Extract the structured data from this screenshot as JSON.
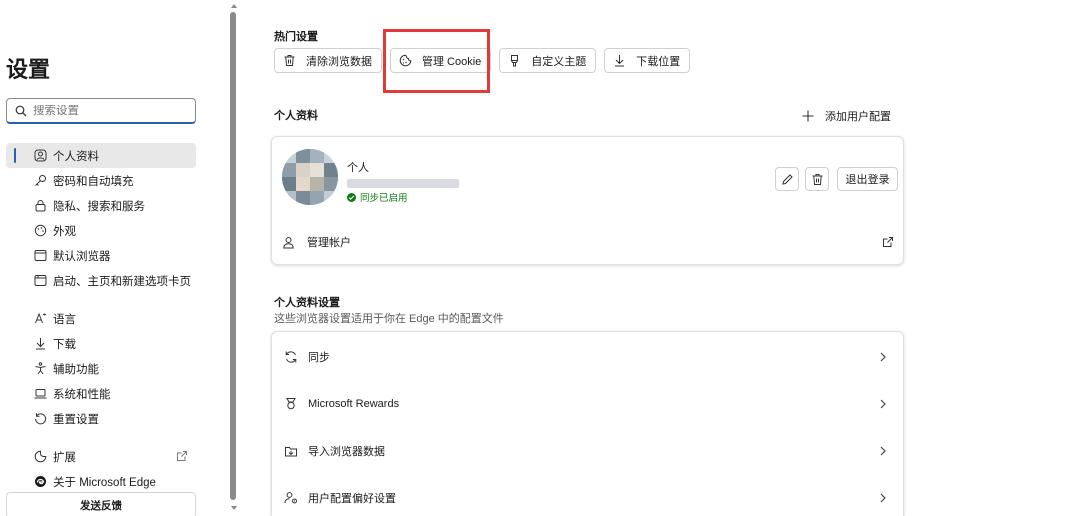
{
  "sidebar": {
    "title": "设置",
    "search_placeholder": "搜索设置",
    "items": [
      {
        "label": "个人资料",
        "icon": "profile-icon",
        "active": true
      },
      {
        "label": "密码和自动填充",
        "icon": "key-icon"
      },
      {
        "label": "隐私、搜索和服务",
        "icon": "lock-icon"
      },
      {
        "label": "外观",
        "icon": "appearance-icon"
      },
      {
        "label": "默认浏览器",
        "icon": "browser-icon"
      },
      {
        "label": "启动、主页和新建选项卡页",
        "icon": "home-tab-icon"
      },
      {
        "label": "语言",
        "icon": "language-icon"
      },
      {
        "label": "下载",
        "icon": "download-icon"
      },
      {
        "label": "辅助功能",
        "icon": "accessibility-icon"
      },
      {
        "label": "系统和性能",
        "icon": "laptop-icon"
      },
      {
        "label": "重置设置",
        "icon": "reset-icon"
      },
      {
        "label": "扩展",
        "icon": "extensions-icon"
      },
      {
        "label": "关于 Microsoft Edge",
        "icon": "edge-icon"
      }
    ],
    "feedback_label": "发送反馈"
  },
  "hot_settings": {
    "title": "热门设置",
    "buttons": [
      {
        "label": "清除浏览数据",
        "icon": "trash-icon"
      },
      {
        "label": "管理 Cookie",
        "icon": "cookie-icon"
      },
      {
        "label": "自定义主题",
        "icon": "paint-brush-icon"
      },
      {
        "label": "下载位置",
        "icon": "download-icon"
      }
    ],
    "highlight_color": "#e03a3a"
  },
  "profile": {
    "section_title": "个人资料",
    "add_profile_label": "添加用户配置",
    "name": "个人",
    "sync_status": "同步已启用",
    "signout_label": "退出登录",
    "manage_account_label": "管理帐户"
  },
  "profile_settings": {
    "title": "个人资料设置",
    "subtitle": "这些浏览器设置适用于你在 Edge 中的配置文件",
    "rows": [
      {
        "label": "同步",
        "icon": "sync-icon"
      },
      {
        "label": "Microsoft Rewards",
        "icon": "medal-icon"
      },
      {
        "label": "导入浏览器数据",
        "icon": "import-icon"
      },
      {
        "label": "用户配置偏好设置",
        "icon": "profile-settings-icon"
      }
    ]
  },
  "colors": {
    "accent": "#2b5fa8",
    "sync_green": "#107c10"
  }
}
